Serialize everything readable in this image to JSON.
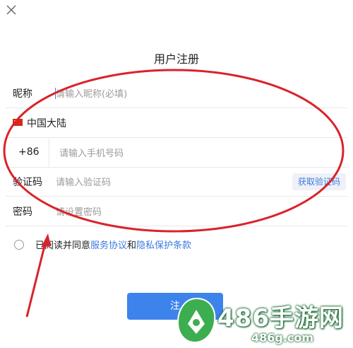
{
  "dialog": {
    "title": "用户注册",
    "close_icon": "close-icon"
  },
  "form": {
    "nickname": {
      "label": "昵称",
      "placeholder": "请输入昵称(必填)"
    },
    "region": {
      "flag_icon": "china-flag-icon",
      "label": "中国大陆"
    },
    "phone": {
      "country_code": "+86",
      "placeholder": "请输入手机号码"
    },
    "verify": {
      "label": "验证码",
      "placeholder": "请输入验证码",
      "button_label": "获取验证码"
    },
    "password": {
      "label": "密码",
      "placeholder": "请设置密码"
    }
  },
  "agreement": {
    "prefix": "已阅读并同意",
    "service_link": "服务协议",
    "connector": "和",
    "privacy_link": "隐私保护条款"
  },
  "submit": {
    "label": "注"
  },
  "annotation": {
    "color": "#d9232a"
  },
  "watermark": {
    "title": "486手游网",
    "site": "486g.com"
  },
  "colors": {
    "accent": "#3d83ec",
    "link": "#3d7be0"
  }
}
